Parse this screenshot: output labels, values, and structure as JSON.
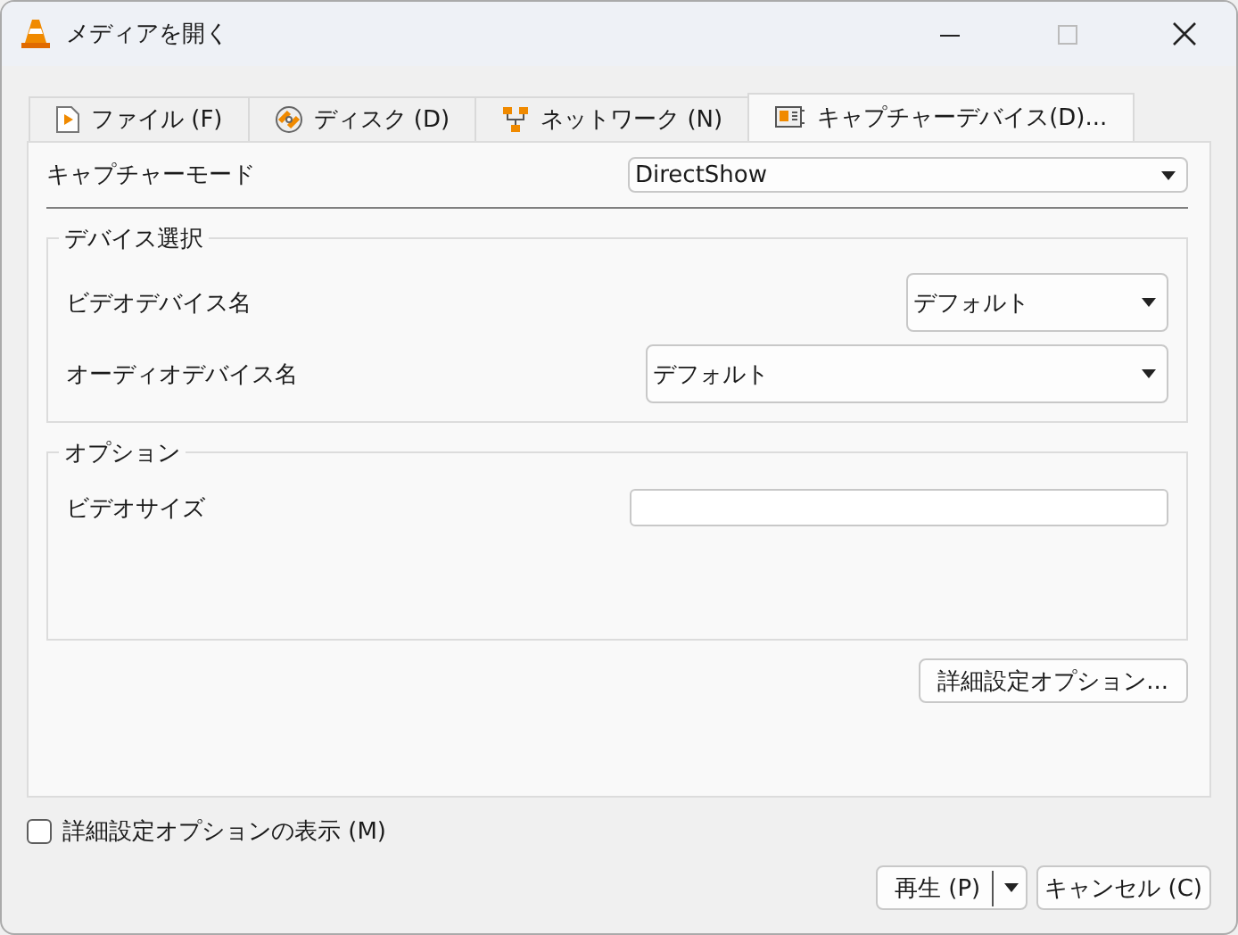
{
  "window": {
    "title": "メディアを開く"
  },
  "tabs": [
    {
      "kind": "file",
      "label": "ファイル (F)",
      "selected": false
    },
    {
      "kind": "disc",
      "label": "ディスク (D)",
      "selected": false
    },
    {
      "kind": "network",
      "label": "ネットワーク (N)",
      "selected": false
    },
    {
      "kind": "capture",
      "label": "キャプチャーデバイス(D)...",
      "selected": true
    }
  ],
  "capture_mode": {
    "label": "キャプチャーモード",
    "value": "DirectShow"
  },
  "device_group": {
    "title": "デバイス選択",
    "video": {
      "label": "ビデオデバイス名",
      "value": "デフォルト"
    },
    "audio": {
      "label": "オーディオデバイス名",
      "value": "デフォルト"
    }
  },
  "options_group": {
    "title": "オプション",
    "video_size": {
      "label": "ビデオサイズ"
    }
  },
  "advanced_button": "詳細設定オプション...",
  "show_advanced": {
    "label": "詳細設定オプションの表示 (M)",
    "checked": false
  },
  "buttons": {
    "play": "再生 (P)",
    "cancel": "キャンセル (C)"
  }
}
